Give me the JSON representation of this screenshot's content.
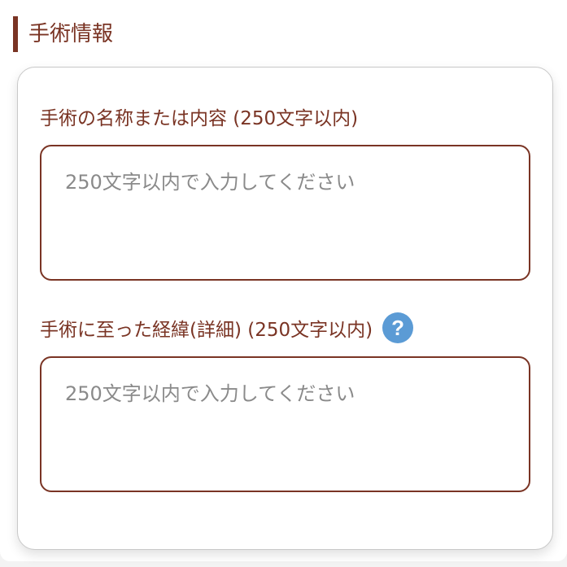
{
  "section": {
    "title": "手術情報"
  },
  "fields": [
    {
      "label": "手術の名称または内容 (250文字以内)",
      "placeholder": "250文字以内で入力してください",
      "value": ""
    },
    {
      "label": "手術に至った経緯(詳細) (250文字以内)",
      "placeholder": "250文字以内で入力してください",
      "value": "",
      "help_icon": "question-circle-icon"
    }
  ],
  "colors": {
    "accent": "#7a3424",
    "help": "#5b9bd5",
    "placeholder": "#8a8a8a",
    "border": "#c8c8c8"
  }
}
